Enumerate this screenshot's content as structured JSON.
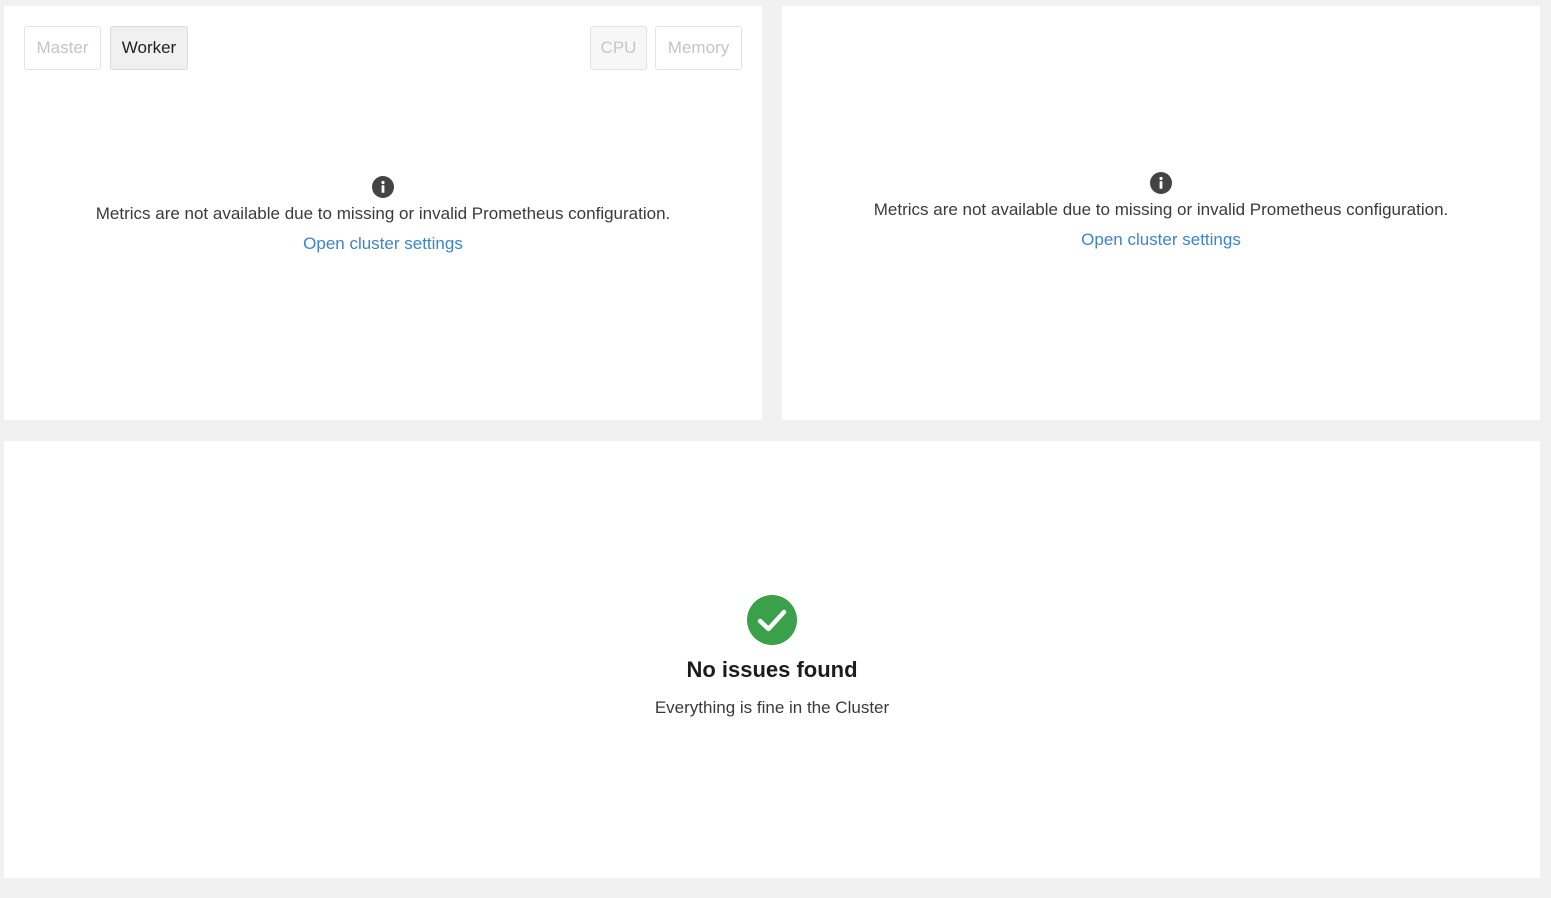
{
  "node_toggle": {
    "master_label": "Master",
    "worker_label": "Worker",
    "selected": "Worker"
  },
  "metric_toggle": {
    "cpu_label": "CPU",
    "memory_label": "Memory"
  },
  "metrics_panel_left": {
    "icon": "info-icon",
    "message": "Metrics are not available due to missing or invalid Prometheus configuration.",
    "link_label": "Open cluster settings"
  },
  "metrics_panel_right": {
    "icon": "info-icon",
    "message": "Metrics are not available due to missing or invalid Prometheus configuration.",
    "link_label": "Open cluster settings"
  },
  "issues_panel": {
    "icon": "check-circle-icon",
    "title": "No issues found",
    "subtitle": "Everything is fine in the Cluster"
  },
  "colors": {
    "background": "#f1f1f1",
    "panel": "#ffffff",
    "link": "#3e84c7",
    "success": "#3aa04a",
    "info_icon": "#444444"
  }
}
